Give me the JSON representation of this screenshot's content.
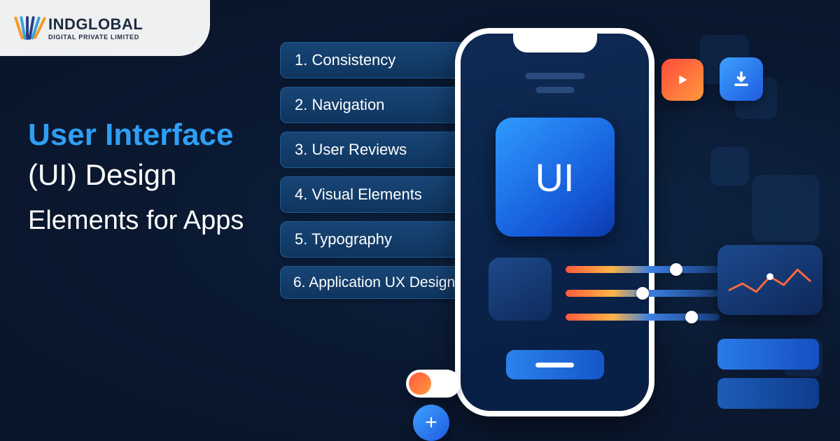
{
  "logo": {
    "brand": "INDGLOBAL",
    "tagline": "DIGITAL PRIVATE LIMITED"
  },
  "heading": {
    "line1": "User Interface",
    "line2": "(UI) Design",
    "line3": "Elements for Apps"
  },
  "list": {
    "items": [
      "1.  Consistency",
      "2. Navigation",
      "3. User Reviews",
      "4. Visual Elements",
      "5. Typography",
      "6. Application UX Design"
    ]
  },
  "phone": {
    "tile_label": "UI"
  },
  "icons": {
    "plus": "+"
  }
}
